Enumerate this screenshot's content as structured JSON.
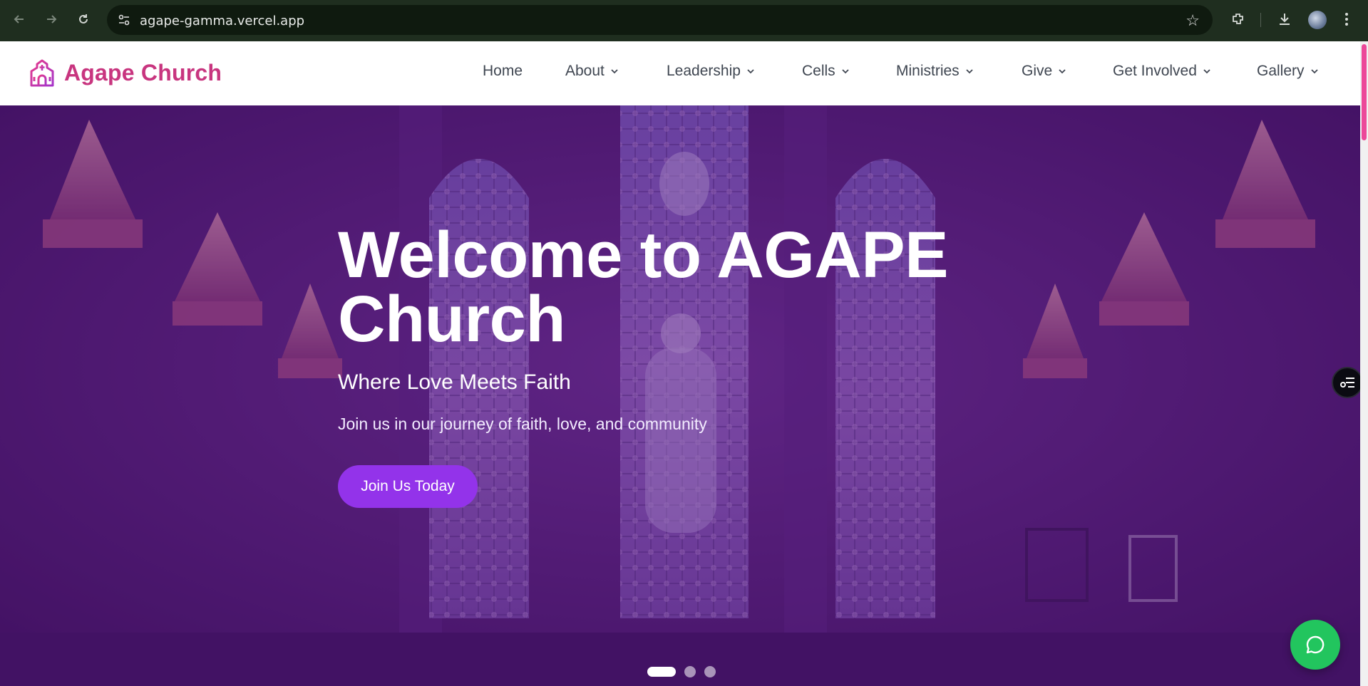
{
  "browser": {
    "url": "agape-gamma.vercel.app",
    "icons": [
      "back-arrow-icon",
      "forward-arrow-icon",
      "reload-icon",
      "site-info-icon",
      "bookmark-star-icon",
      "extensions-icon",
      "download-icon",
      "profile-avatar",
      "more-menu-icon"
    ]
  },
  "header": {
    "brand_name": "Agape Church",
    "brand_color": "#c8357f",
    "nav": [
      {
        "label": "Home",
        "dropdown": false
      },
      {
        "label": "About",
        "dropdown": true
      },
      {
        "label": "Leadership",
        "dropdown": true
      },
      {
        "label": "Cells",
        "dropdown": true
      },
      {
        "label": "Ministries",
        "dropdown": true
      },
      {
        "label": "Give",
        "dropdown": true
      },
      {
        "label": "Get Involved",
        "dropdown": true
      },
      {
        "label": "Gallery",
        "dropdown": true
      }
    ]
  },
  "hero": {
    "title_line1": "Welcome to AGAPE",
    "title_line2": "Church",
    "tagline": "Where Love Meets Faith",
    "subtitle": "Join us in our journey of faith, love, and community",
    "cta_label": "Join Us Today",
    "cta_color": "#9333ea",
    "slides_total": 3,
    "active_slide": 1
  },
  "widgets": {
    "chat_color": "#22c55e"
  }
}
